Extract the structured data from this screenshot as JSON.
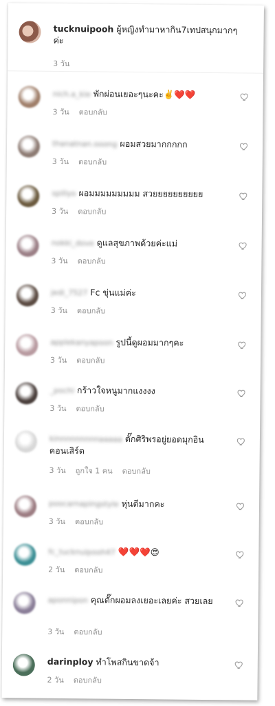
{
  "post": {
    "username": "tucknuipooh",
    "caption": "ผู้หญิงทำมาหากิน7เทปสนุกมากๆค่ะ",
    "time": "3 วัน"
  },
  "reply_label": "ตอบกลับ",
  "comments": [
    {
      "username": "nich.a_kie",
      "text": "พักผ่อนเยอะๆนะคะ✌️❤️❤️",
      "time": "3 วัน",
      "avatar_color": "#a07f6a"
    },
    {
      "username": "thanatnan.ooong",
      "text": "ผอมสวยมากกกกก",
      "time": "3 วัน",
      "avatar_color": "#8d7b73"
    },
    {
      "username": "spillyo",
      "text": "ผอมมมมมมมมม สวยยยยยยยยยย",
      "time": "3 วัน",
      "avatar_color": "#6b5a3e"
    },
    {
      "username": "nokki_dove",
      "text": "ดูแลสุขภาพด้วยค่ะแม่",
      "time": "3 วัน",
      "avatar_color": "#9b7f86"
    },
    {
      "username": "jedi_7527",
      "text": "Fc ขุ่นแม่ค่ะ",
      "time": "3 วัน",
      "avatar_color": "#5b4b42"
    },
    {
      "username": "applekanyapoon",
      "text": "รูปนี้ดูผอมมากๆคะ",
      "time": "3 วัน",
      "avatar_color": "#b89aa0"
    },
    {
      "username": "_pochi",
      "text": "กร้าวใจหนูมากแงงงง",
      "time": "3 วัน",
      "avatar_color": "#4a3f3c"
    },
    {
      "username": "kinnnnnnnnnaaaaa",
      "text": "ตั๊กศิริพรอยู่ยอดมุกอินคอนเสิร์ต",
      "time": "3 วัน",
      "likes": "ถูกใจ 1 คน",
      "avatar_color": "#d8d8d8"
    },
    {
      "username": "poocarnapingstyle",
      "text": "หุ่นดีมากคะ",
      "time": "3 วัน",
      "avatar_color": "#9c7c82"
    },
    {
      "username": "fc_tucknuipooh47",
      "text": "❤️❤️❤️😍",
      "time": "2 วัน",
      "avatar_color": "#3c8f95"
    },
    {
      "username": "aponnipon",
      "text": "คุณตั๊กผอมลงเยอะเลยค่ะ สวยเลย",
      "time": "3 วัน",
      "avatar_color": "#8a7e98"
    },
    {
      "username": "darinploy",
      "text": "ทำโพสกินขาดจ้า",
      "time": "2 วัน",
      "avatar_color": "#4b6f5a"
    }
  ]
}
